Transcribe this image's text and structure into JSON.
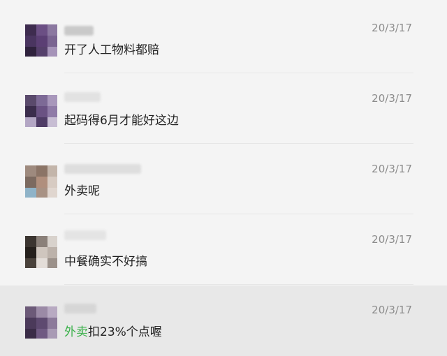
{
  "comments": [
    {
      "message": "开了人工物料都赔",
      "time": "20/3/17"
    },
    {
      "message": "起码得6月才能好这边",
      "time": "20/3/17"
    },
    {
      "message": "外卖呢",
      "time": "20/3/17"
    },
    {
      "message": "中餐确实不好搞",
      "time": "20/3/17"
    },
    {
      "message_highlight": "外卖",
      "message_rest": "扣23%个点喔",
      "time": "20/3/17"
    }
  ],
  "colors": {
    "background": "#f4f4f4",
    "selected_row": "#e8e8e8",
    "highlight_text": "#3bb14b",
    "time_text": "#8c8c8c"
  }
}
